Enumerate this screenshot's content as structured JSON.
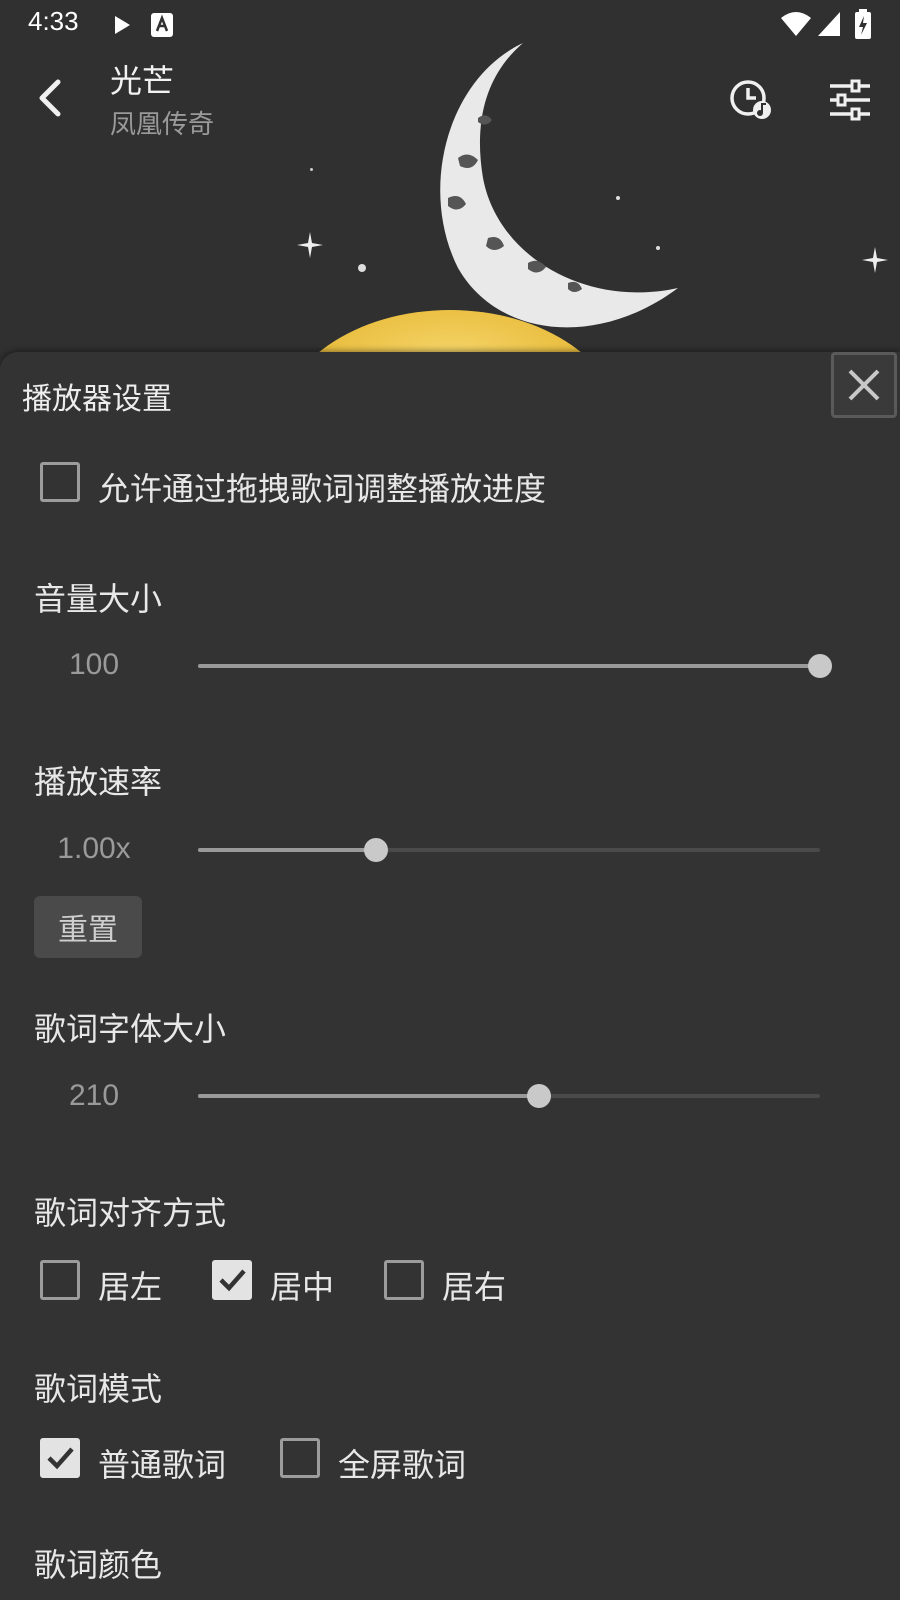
{
  "status_bar": {
    "time": "4:33"
  },
  "app_bar": {
    "title": "光芒",
    "subtitle": "凤凰传奇"
  },
  "sheet": {
    "title": "播放器设置",
    "drag_lyrics": {
      "label": "允许通过拖拽歌词调整播放进度",
      "checked": false
    },
    "volume": {
      "label": "音量大小",
      "value": "100",
      "fraction": 1.0
    },
    "speed": {
      "label": "播放速率",
      "value": "1.00x",
      "fraction": 0.286,
      "reset_label": "重置"
    },
    "lyric_font": {
      "label": "歌词字体大小",
      "value": "210",
      "fraction": 0.549
    },
    "alignment": {
      "label": "歌词对齐方式",
      "options": [
        {
          "label": "居左",
          "checked": false
        },
        {
          "label": "居中",
          "checked": true
        },
        {
          "label": "居右",
          "checked": false
        }
      ]
    },
    "lyric_mode": {
      "label": "歌词模式",
      "options": [
        {
          "label": "普通歌词",
          "checked": true
        },
        {
          "label": "全屏歌词",
          "checked": false
        }
      ]
    },
    "lyric_color": {
      "label": "歌词颜色"
    }
  }
}
